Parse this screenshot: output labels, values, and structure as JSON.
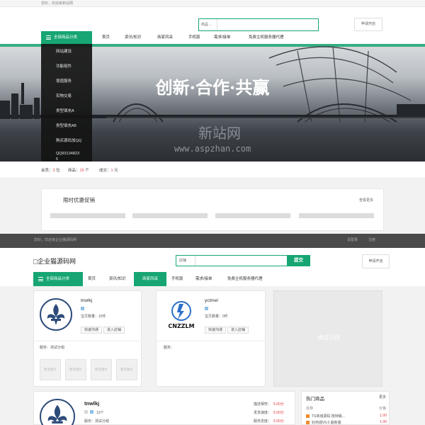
{
  "top1": {
    "text": "您好，欢迎来新站网"
  },
  "header1": {
    "search_scope": "商品",
    "apply_shop": "申请开店"
  },
  "nav1": {
    "category_button": "全部商品分类",
    "items": [
      "首页",
      "资讯/知识",
      "商家风采",
      "手机版",
      "需求/接单",
      "免费主机服务器代理"
    ]
  },
  "categories": [
    "网站建设",
    "功能组件",
    "增值服务",
    "实物交易",
    "类型填充A",
    "类型填充A8",
    "购买源码加QQ",
    "QQ93134823",
    "5"
  ],
  "hero": {
    "slogan": "创新·合作·共赢",
    "watermark_title": "新站网",
    "watermark_url": "www.aspzhan.com"
  },
  "stats": {
    "members_label": "会员：",
    "members_value": "3",
    "members_unit": "位",
    "goods_label": "商品：",
    "goods_value": "15",
    "goods_unit": "个",
    "deals_label": "成交：",
    "deals_value": "1",
    "deals_unit": "元"
  },
  "promo": {
    "title": "限时优惠促销",
    "more": "查看更多"
  },
  "top2": {
    "left": "您好，欢迎来企业猫源码网",
    "right1": "请登录",
    "right2": "注册"
  },
  "header2": {
    "logo_alt": "企业猫源码网",
    "search_scope": "店铺",
    "search_button": "提交",
    "apply_shop": "申请开店"
  },
  "nav2": {
    "category_button": "全部商品分类",
    "items": [
      "首页",
      "资讯/知识",
      "商家风采",
      "手机版",
      "需求/接单",
      "免费主机服务器代理"
    ],
    "active_index": 2
  },
  "shops": [
    {
      "name": "tnwlkj",
      "count_label": "宝贝数量：",
      "count": "15件",
      "btn1": "快速沟通",
      "btn2": "进入店铺",
      "category": "服务：测试分组"
    },
    {
      "name": "yctmel",
      "count_label": "宝贝数量：",
      "count": "0件",
      "btn1": "快速沟通",
      "btn2": "进入店铺",
      "category": "服务："
    }
  ],
  "thumb_label": "暂无图片",
  "cnzzlm_logo": "CNZZLM",
  "ad_placeholder": "虚位以待",
  "shop_detail": {
    "name": "tnwlkj",
    "count": "13个",
    "category": "服务：测试分组",
    "ratings": [
      {
        "label": "描述相符：",
        "value": "5.00分"
      },
      {
        "label": "发货速度：",
        "value": "5.00分"
      },
      {
        "label": "服务态度：",
        "value": "5.00分"
      }
    ]
  },
  "hot": {
    "title": "热门商品",
    "more": "更多",
    "col1": "名称",
    "col2": "价格",
    "items": [
      {
        "name": "TS商城源码 按钟版...",
        "price": "1.00"
      },
      {
        "name": "好商城V5.0 最新版",
        "price": "1.00"
      }
    ]
  },
  "colors": {
    "accent": "#17a673",
    "price": "#e4393c"
  }
}
